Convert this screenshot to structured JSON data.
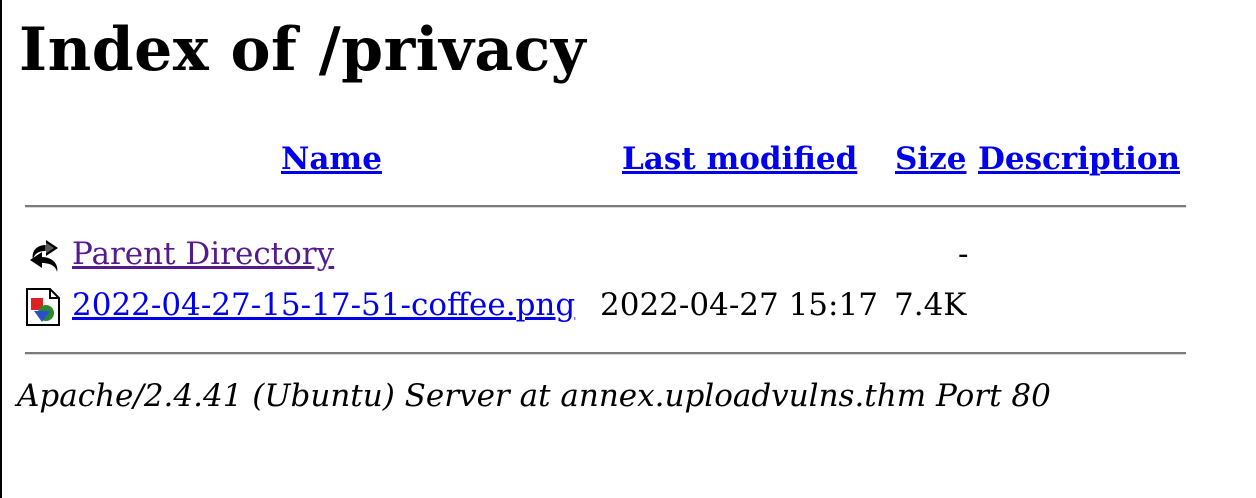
{
  "page": {
    "title": "Index of /privacy"
  },
  "table": {
    "headers": {
      "name": "Name",
      "last_modified": "Last modified",
      "size": "Size",
      "description": "Description"
    },
    "rows": [
      {
        "icon": "back-arrow-icon",
        "name": "Parent Directory",
        "last_modified": "",
        "size": "-",
        "description": ""
      },
      {
        "icon": "image-file-icon",
        "name": "2022-04-27-15-17-51-coffee.png",
        "last_modified": "2022-04-27 15:17",
        "size": "7.4K",
        "description": ""
      }
    ]
  },
  "footer": {
    "server_signature": "Apache/2.4.41 (Ubuntu) Server at annex.uploadvulns.thm Port 80"
  },
  "colors": {
    "link": "#0000ee",
    "visited_link": "#551a8b",
    "rule": "#7a7a7a"
  }
}
